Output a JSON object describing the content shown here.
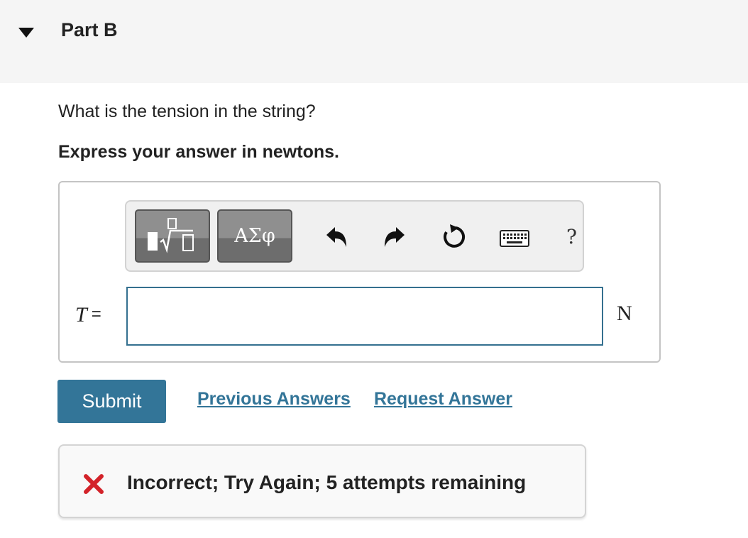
{
  "part": {
    "title": "Part B",
    "toggle_icon": "caret-down-icon"
  },
  "question": {
    "text": "What is the tension in the string?",
    "instruction": "Express your answer in newtons."
  },
  "toolbar": {
    "templates_icon": "templates-icon",
    "symbols_label": "ΑΣφ",
    "undo_icon": "undo-icon",
    "redo_icon": "redo-icon",
    "reset_icon": "reset-icon",
    "keyboard_icon": "keyboard-icon",
    "help_label": "?"
  },
  "answer": {
    "variable": "T",
    "equals": "=",
    "value": "",
    "unit": "N"
  },
  "actions": {
    "submit_label": "Submit",
    "previous_answers_label": "Previous Answers",
    "request_answer_label": "Request Answer"
  },
  "feedback": {
    "icon": "x-icon",
    "message": "Incorrect; Try Again; 5 attempts remaining",
    "color": "#d3232a"
  },
  "colors": {
    "accent": "#337598",
    "header_bg": "#f5f5f5",
    "input_border": "#34708f"
  }
}
